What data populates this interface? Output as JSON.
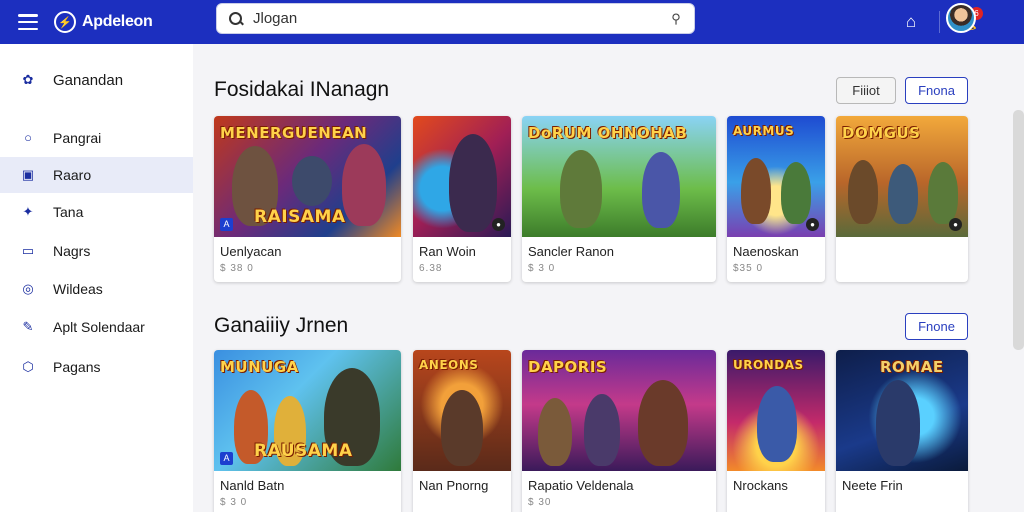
{
  "app": {
    "name": "Apdeleon",
    "logo_mark": "⚡"
  },
  "search": {
    "value": "Jlogan",
    "placeholder": ""
  },
  "topbar": {
    "notif_count": "6",
    "icons": [
      "home-icon",
      "bell-icon"
    ]
  },
  "sidebar": {
    "items": [
      {
        "label": "Ganandan",
        "icon": "✿"
      },
      {
        "label": "Pangrai",
        "icon": "○"
      },
      {
        "label": "Raaro",
        "icon": "▣"
      },
      {
        "label": "Tana",
        "icon": "✦"
      },
      {
        "label": "Nagrs",
        "icon": "▭"
      },
      {
        "label": "Wildeas",
        "icon": "◎"
      },
      {
        "label": "Aplt Solendaar",
        "icon": "✎"
      },
      {
        "label": "Pagans",
        "icon": "⬡"
      }
    ]
  },
  "sections": [
    {
      "title": "Fosidakai INanagn",
      "buttons": [
        "Fiiiot",
        "Fnona"
      ],
      "cards": [
        {
          "title": "Uenlyacan",
          "sub": "$ 38 0",
          "word_top": "MENERGUENEAN",
          "word_bottom": "RAISAMA"
        },
        {
          "title": "Ran Woin",
          "sub": "6.38",
          "word_top": "",
          "word_bottom": ""
        },
        {
          "title": "Sancler Ranon",
          "sub": "$ 3 0",
          "word_top": "DoRUM  OHNOHAB",
          "word_bottom": ""
        },
        {
          "title": "Naenoskan",
          "sub": "$35 0",
          "word_top": "AURMUS",
          "word_bottom": ""
        },
        {
          "title": "",
          "sub": "",
          "word_top": "DOMGUS",
          "word_bottom": ""
        }
      ]
    },
    {
      "title": "Ganaiiiy Jrnen",
      "buttons": [
        "Fnone"
      ],
      "cards": [
        {
          "title": "Nanld Batn",
          "sub": "$ 3 0",
          "word_top": "MUNUGA",
          "word_bottom": "RAUSAMA"
        },
        {
          "title": "Nan Pnorng",
          "sub": "",
          "word_top": "ANEONS",
          "word_bottom": ""
        },
        {
          "title": "Rapatio Veldenala",
          "sub": "$ 30",
          "word_top": "DAPORIS",
          "word_bottom": ""
        },
        {
          "title": "Nrockans",
          "sub": "",
          "word_top": "URONDAS",
          "word_bottom": ""
        },
        {
          "title": "Neete Frin",
          "sub": "",
          "word_top": "ROMAE",
          "word_bottom": ""
        }
      ]
    }
  ],
  "colors": {
    "accent": "#1c2fbf",
    "button_outline": "#2a3fbf"
  }
}
